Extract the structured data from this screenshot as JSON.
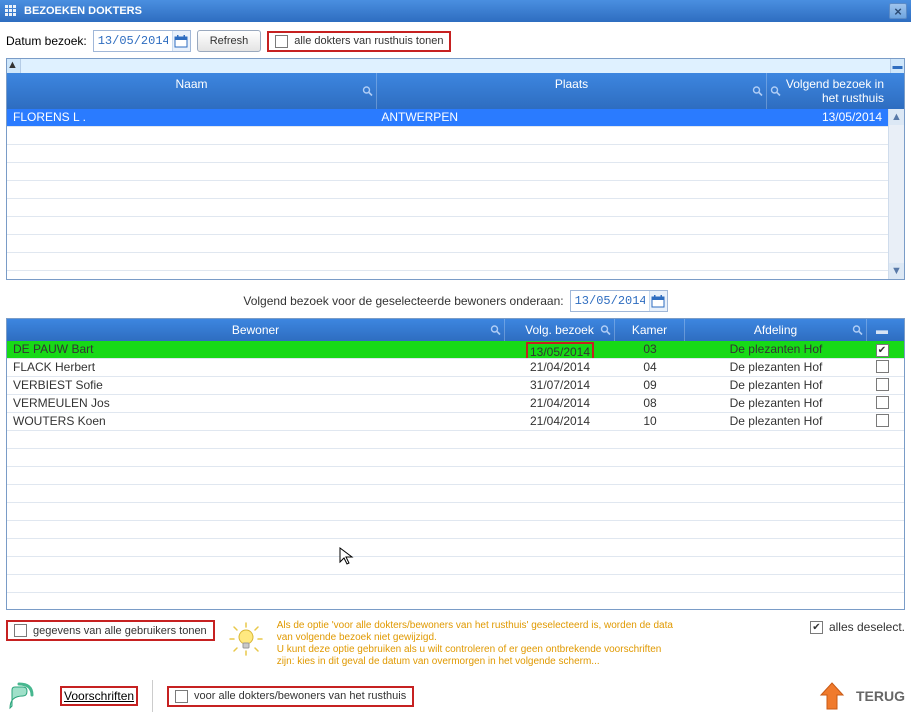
{
  "window": {
    "title": "BEZOEKEN DOKTERS"
  },
  "toolbar": {
    "date_label": "Datum bezoek:",
    "date_value": "13/05/2014",
    "refresh_label": "Refresh",
    "all_doctors_label": "alle dokters van rusthuis tonen"
  },
  "grid1": {
    "headers": {
      "naam": "Naam",
      "plaats": "Plaats",
      "volgend": "Volgend bezoek in het rusthuis"
    },
    "rows": [
      {
        "naam": "FLORENS L .",
        "plaats": "ANTWERPEN",
        "volgend": "13/05/2014",
        "selected": true
      }
    ]
  },
  "mid": {
    "label": "Volgend bezoek voor de geselecteerde bewoners onderaan:",
    "date": "13/05/2014"
  },
  "grid2": {
    "headers": {
      "bewoner": "Bewoner",
      "volg": "Volg. bezoek",
      "kamer": "Kamer",
      "afdeling": "Afdeling"
    },
    "rows": [
      {
        "bewoner": "DE PAUW Bart",
        "volg": "13/05/2014",
        "kamer": "03",
        "afdeling": "De plezanten Hof",
        "checked": true,
        "highlight": true
      },
      {
        "bewoner": "FLACK Herbert",
        "volg": "21/04/2014",
        "kamer": "04",
        "afdeling": "De plezanten Hof",
        "checked": false,
        "highlight": false
      },
      {
        "bewoner": "VERBIEST Sofie",
        "volg": "31/07/2014",
        "kamer": "09",
        "afdeling": "De plezanten Hof",
        "checked": false,
        "highlight": false
      },
      {
        "bewoner": "VERMEULEN Jos",
        "volg": "21/04/2014",
        "kamer": "08",
        "afdeling": "De plezanten Hof",
        "checked": false,
        "highlight": false
      },
      {
        "bewoner": "WOUTERS Koen",
        "volg": "21/04/2014",
        "kamer": "10",
        "afdeling": "De plezanten Hof",
        "checked": false,
        "highlight": false
      }
    ]
  },
  "options": {
    "show_all_users": "gegevens van alle gebruikers tonen",
    "deselect_all": "alles deselect.",
    "for_all_doctors": "voor alle dokters/bewoners van het rusthuis"
  },
  "hint": "Als de optie 'voor alle dokters/bewoners van het rusthuis' geselecteerd is, worden de data van volgende bezoek niet gewijzigd.\nU kunt deze optie gebruiken als u wilt controleren of er geen ontbrekende voorschriften zijn: kies in dit geval de datum van overmorgen in het volgende scherm...",
  "footer": {
    "voorschriften": "Voorschriften",
    "terug": "TERUG"
  }
}
